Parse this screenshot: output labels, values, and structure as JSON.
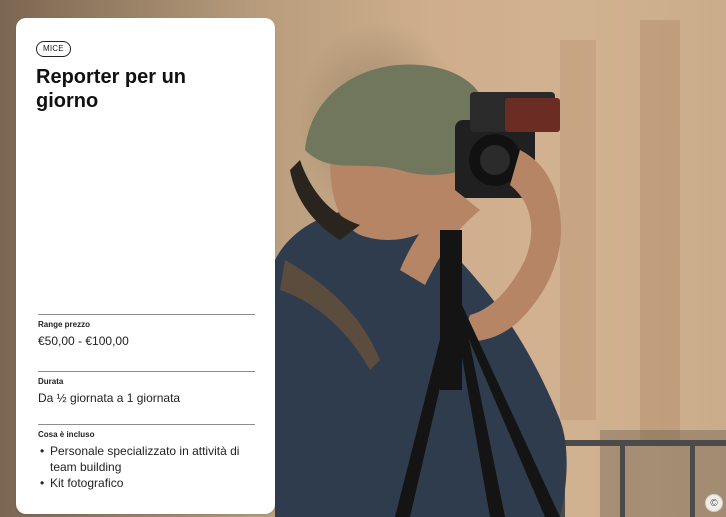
{
  "card": {
    "tag": "MICE",
    "title": "Reporter per un giorno",
    "price": {
      "label": "Range prezzo",
      "value": "€50,00 - €100,00"
    },
    "duration": {
      "label": "Durata",
      "value": "Da ½ giornata a 1 giornata"
    },
    "includes": {
      "label": "Cosa è incluso",
      "items": [
        "Personale specializzato in attività di team building",
        "Kit fotografico"
      ]
    }
  },
  "image": {
    "subject": "photographer-with-camera-on-tripod"
  },
  "icons": {
    "corner": "info-icon"
  },
  "colors": {
    "card_bg": "#ffffff",
    "text": "#111111",
    "divider": "#8e8e8e"
  }
}
